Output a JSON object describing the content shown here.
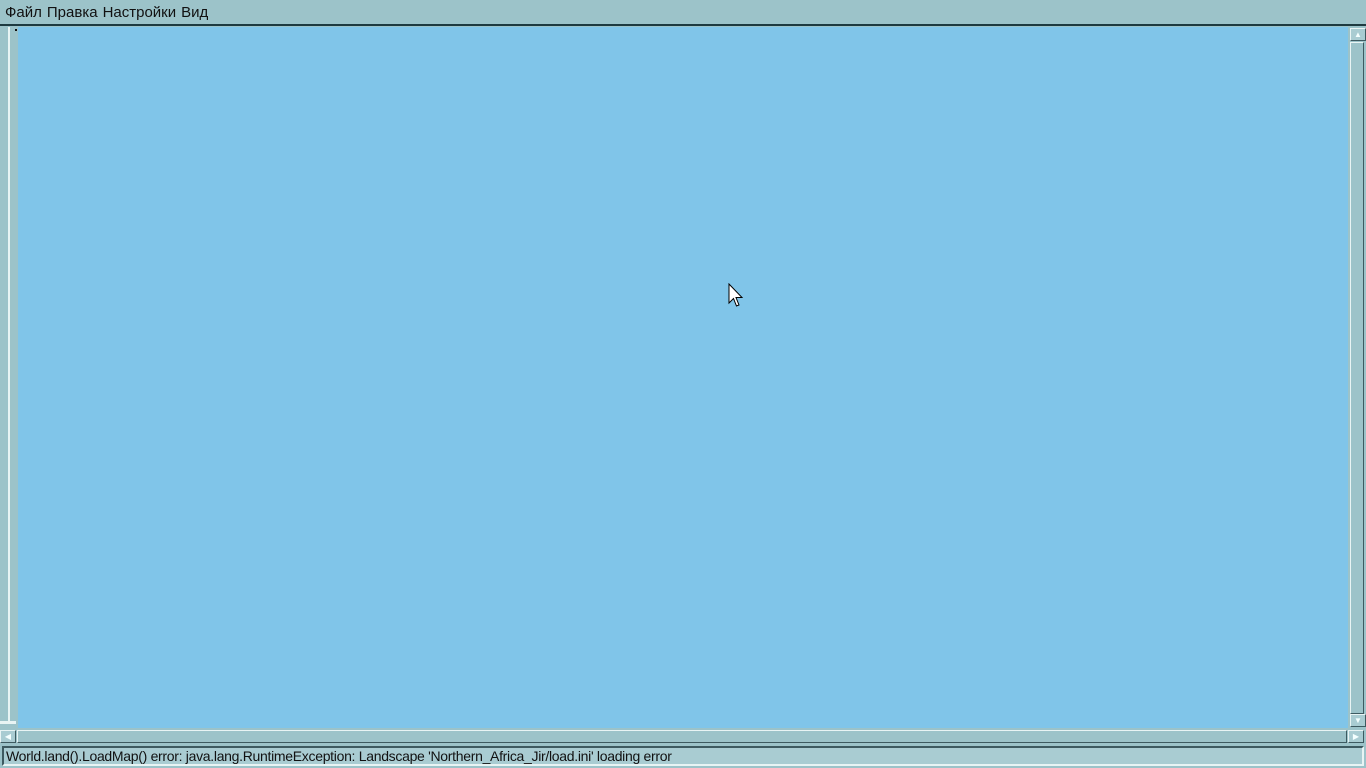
{
  "menu": {
    "items": [
      "Файл",
      "Правка",
      "Настройки",
      "Вид"
    ]
  },
  "status": {
    "text": "World.land().LoadMap() error: java.lang.RuntimeException: Landscape 'Northern_Africa_Jir/load.ini' loading error"
  },
  "colors": {
    "canvas": "#80c5e9",
    "chrome": "#9cc3c9"
  }
}
